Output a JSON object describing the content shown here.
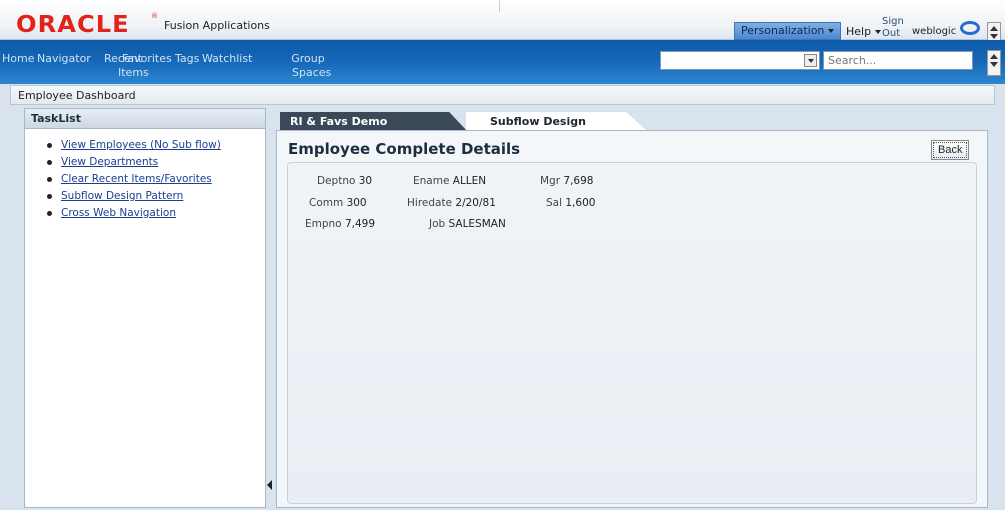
{
  "brand": {
    "logo_text": "ORACLE",
    "app_name": "Fusion Applications",
    "personalization_label": "Personalization",
    "help_label": "Help",
    "signout_label": "Sign Out",
    "user_name": "weblogic"
  },
  "nav": {
    "home": "Home",
    "navigator": "Navigator",
    "recent": "Recent",
    "recent_sub": "Items",
    "favorites": "Favorites",
    "tags": "Tags",
    "watchlist": "Watchlist",
    "group": "Group",
    "group_sub": "Spaces",
    "search_placeholder": "Search..."
  },
  "dashboard": {
    "title": "Employee Dashboard"
  },
  "tasklist": {
    "header": "TaskList",
    "items": [
      "View Employees (No Sub flow)",
      "View Departments",
      "Clear Recent Items/Favorites",
      "Subflow Design Pattern",
      "Cross Web Navigation"
    ]
  },
  "tabs": {
    "tab1": "RI & Favs Demo Introduction",
    "tab2": "Subflow Design Pattern"
  },
  "details": {
    "title": "Employee Complete Details",
    "back_label": "Back",
    "deptno_label": "Deptno",
    "deptno_value": "30",
    "ename_label": "Ename",
    "ename_value": "ALLEN",
    "mgr_label": "Mgr",
    "mgr_value": "7,698",
    "comm_label": "Comm",
    "comm_value": "300",
    "hiredate_label": "Hiredate",
    "hiredate_value": "2/20/81",
    "sal_label": "Sal",
    "sal_value": "1,600",
    "empno_label": "Empno",
    "empno_value": "7,499",
    "job_label": "Job",
    "job_value": "SALESMAN"
  },
  "colors": {
    "oracle_red": "#e2231a",
    "nav_blue": "#1668b8",
    "link_blue": "#1a3f8f"
  }
}
